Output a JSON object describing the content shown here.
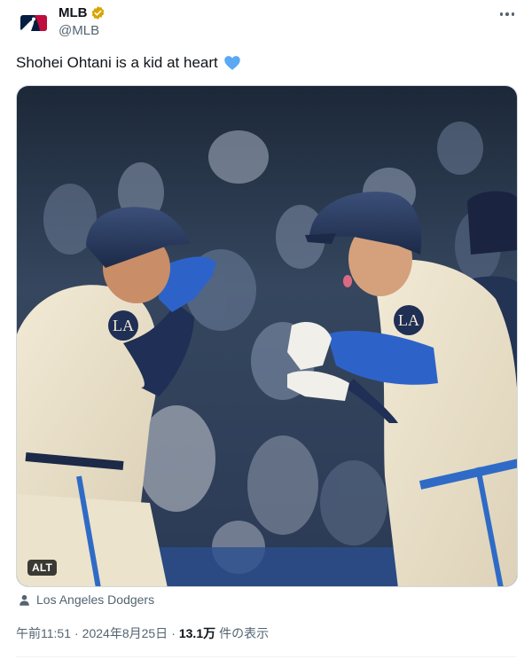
{
  "author": {
    "display_name": "MLB",
    "handle": "@MLB",
    "avatar_icon": "mlb-logo-icon",
    "verified_icon": "verified-badge-icon",
    "verified_color": "#d9a400"
  },
  "more_menu_icon": "more-horizontal-icon",
  "tweet": {
    "text": "Shohei Ohtani is a kid at heart",
    "emoji_icon": "blue-heart-icon",
    "emoji_color": "#5aa9f2"
  },
  "media": {
    "alt_badge": "ALT"
  },
  "tagged": {
    "icon": "person-icon",
    "label": "Los Angeles Dodgers"
  },
  "meta": {
    "time": "午前11:51",
    "separator": "·",
    "date": "2024年8月25日",
    "separator2": "·",
    "views_count": "13.1万",
    "views_label": "件の表示"
  },
  "colors": {
    "text_primary": "#0f1419",
    "text_secondary": "#536471",
    "border": "#cfd9de"
  }
}
